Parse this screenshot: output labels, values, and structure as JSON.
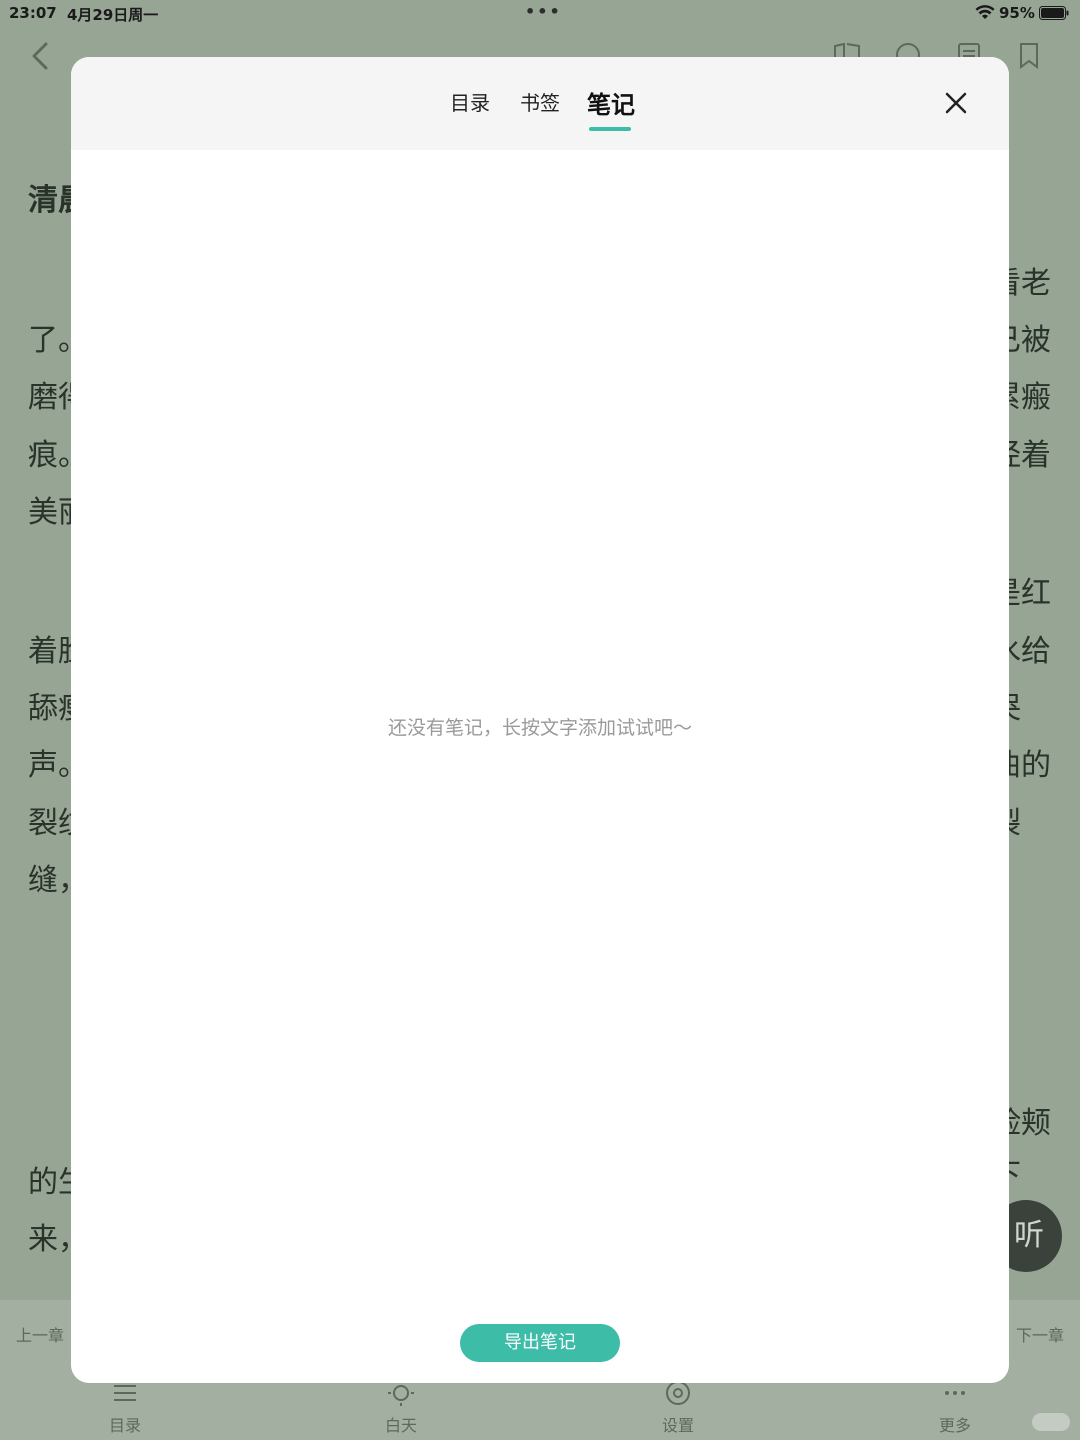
{
  "status_bar": {
    "time": "23:07",
    "date": "4月29日周一",
    "battery": "95%"
  },
  "reader": {
    "title_fragment": "清晨",
    "left_fragments": [
      "了。",
      "磨得",
      "痕。",
      "美丽",
      "着脸",
      "舔瘦",
      "声。",
      "裂纹",
      "缝，",
      "的生",
      "来，"
    ],
    "right_fragments": [
      "看老",
      "已被",
      "累瘢",
      "经着",
      "是红",
      "水给",
      "哭",
      "曲的",
      "裂",
      "脸颊",
      "下"
    ],
    "prev_chapter": "上一章",
    "next_chapter": "下一章",
    "listen_label": "听",
    "bottom_nav": [
      {
        "label": "目录",
        "icon": "list-icon"
      },
      {
        "label": "白天",
        "icon": "sun-icon"
      },
      {
        "label": "设置",
        "icon": "settings-icon"
      },
      {
        "label": "更多",
        "icon": "more-icon"
      }
    ]
  },
  "modal": {
    "tabs": [
      {
        "label": "目录",
        "active": false
      },
      {
        "label": "书签",
        "active": false
      },
      {
        "label": "笔记",
        "active": true
      }
    ],
    "empty_message": "还没有笔记，长按文字添加试试吧～",
    "export_label": "导出笔记",
    "accent_color": "#3dbca8"
  }
}
